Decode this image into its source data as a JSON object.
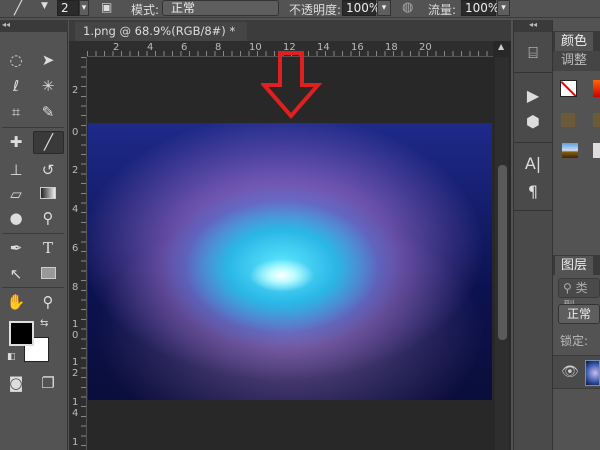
{
  "options_bar": {
    "brush_size": "2",
    "mode_label": "模式:",
    "mode_value": "正常",
    "opacity_label": "不透明度:",
    "opacity_value": "100%",
    "flow_label": "流量:",
    "flow_value": "100%"
  },
  "document": {
    "tab_title": "1.png @ 68.9%(RGB/8#) *",
    "close": "×",
    "h_ruler": [
      "2",
      "4",
      "6",
      "8",
      "10",
      "12",
      "14",
      "16",
      "18",
      "20"
    ],
    "v_ruler": [
      "2",
      "0",
      "2",
      "4",
      "6",
      "8",
      "10",
      "12",
      "14",
      "1"
    ]
  },
  "panels": {
    "color_tab": "颜色",
    "adjust_tab": "调整",
    "layers_tab": "图层",
    "filter_kind": "类型",
    "blend_mode": "正常",
    "lock_label": "锁定:"
  },
  "annotation": {
    "arrow_color": "#e02020"
  }
}
